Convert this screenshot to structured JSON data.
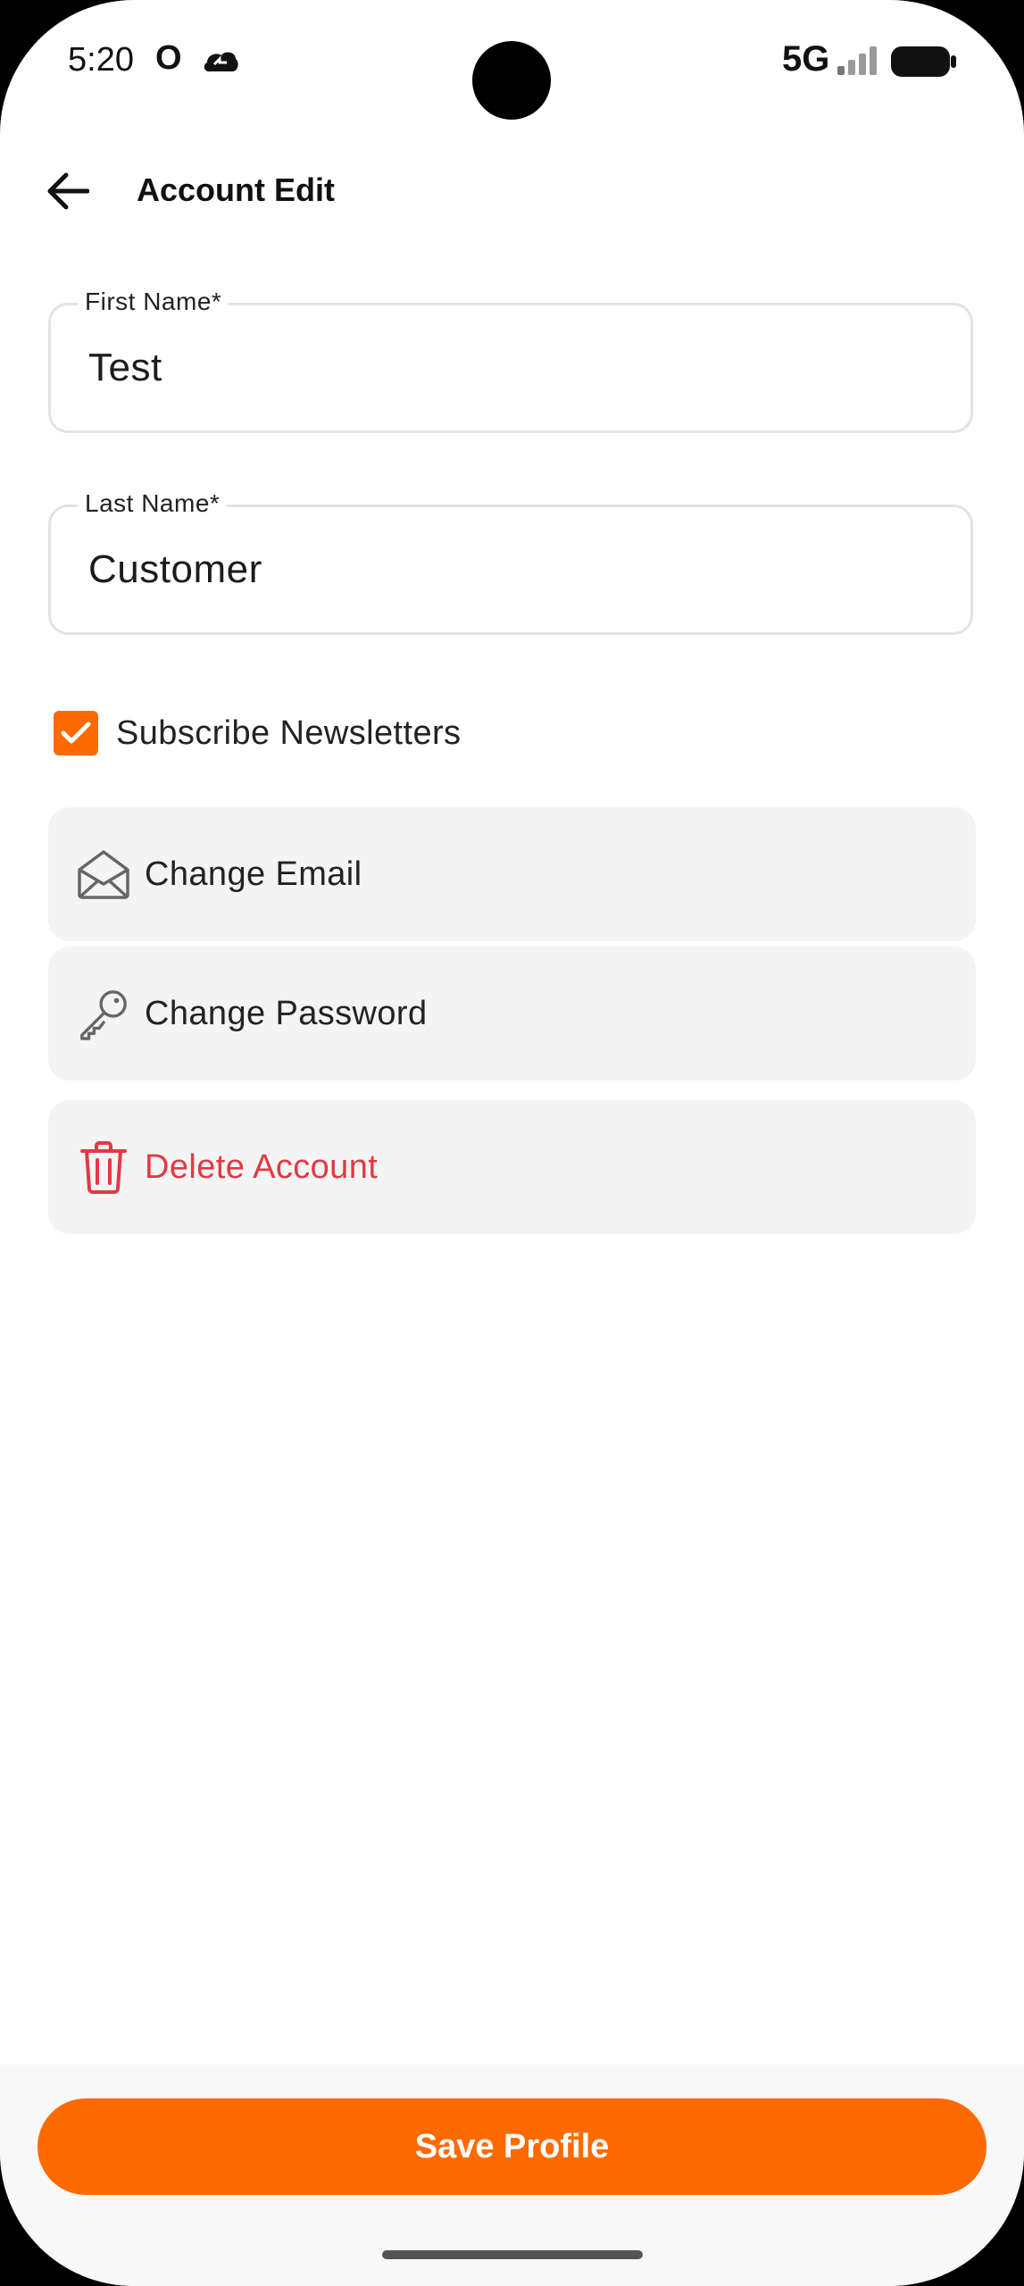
{
  "status_bar": {
    "time": "5:20",
    "indicator": "O",
    "network": "5G"
  },
  "header": {
    "title": "Account Edit",
    "back_icon": "arrow-left-icon"
  },
  "form": {
    "first_name": {
      "label": "First Name*",
      "value": "Test"
    },
    "last_name": {
      "label": "Last Name*",
      "value": "Customer"
    },
    "newsletter": {
      "label": "Subscribe Newsletters",
      "checked": true
    }
  },
  "actions": [
    {
      "label": "Change Email",
      "icon": "envelope-open-icon"
    },
    {
      "label": "Change Password",
      "icon": "key-icon"
    },
    {
      "label": "Delete Account",
      "icon": "trash-icon",
      "color": "#e03a44"
    }
  ],
  "footer": {
    "save_label": "Save Profile"
  },
  "colors": {
    "accent": "#ff6a00",
    "danger": "#e03a44",
    "card_bg": "#f4f4f4"
  }
}
